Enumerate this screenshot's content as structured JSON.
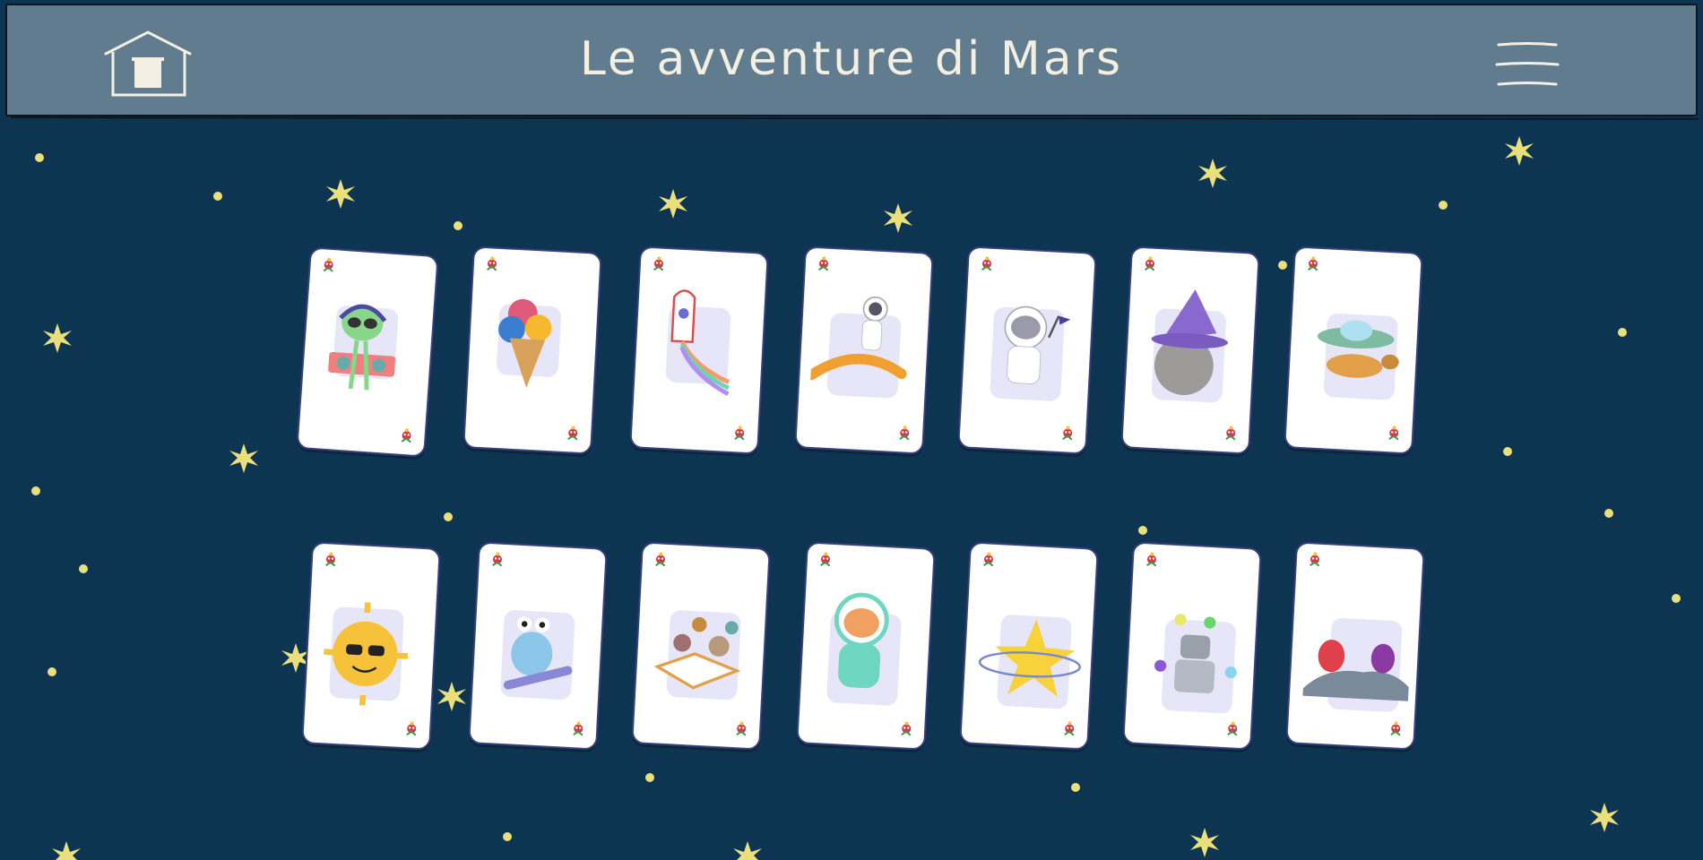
{
  "app": {
    "title": "Le avventure di Mars"
  },
  "header": {
    "home_icon": "home-icon",
    "menu_icon": "hamburger-menu-icon"
  },
  "colors": {
    "background": "#0d3552",
    "header": "#617c8f",
    "title": "#f3efe3",
    "star": "#eadf7a",
    "card_border": "#3a3f7e"
  },
  "cards": [
    {
      "name": "alien-dj",
      "icon": "alien-dj-icon"
    },
    {
      "name": "ice-cream-planets",
      "icon": "ice-cream-icon"
    },
    {
      "name": "rocket-rainbow",
      "icon": "rocket-icon"
    },
    {
      "name": "astronaut-surfer",
      "icon": "astronaut-surf-icon"
    },
    {
      "name": "hippo-astronaut",
      "icon": "hippo-astronaut-icon"
    },
    {
      "name": "moon-wizard",
      "icon": "moon-witch-icon"
    },
    {
      "name": "turtle-ufo",
      "icon": "turtle-ufo-icon"
    },
    {
      "name": "cool-sun",
      "icon": "sun-sunglasses-icon"
    },
    {
      "name": "monster-skateboard",
      "icon": "monster-skate-icon"
    },
    {
      "name": "planets-book",
      "icon": "book-planets-icon"
    },
    {
      "name": "fox-astronaut",
      "icon": "fox-astronaut-icon"
    },
    {
      "name": "star-ring",
      "icon": "star-ring-icon"
    },
    {
      "name": "robot-juggler",
      "icon": "robot-icon"
    },
    {
      "name": "aliens-on-moon",
      "icon": "aliens-moon-icon"
    }
  ]
}
